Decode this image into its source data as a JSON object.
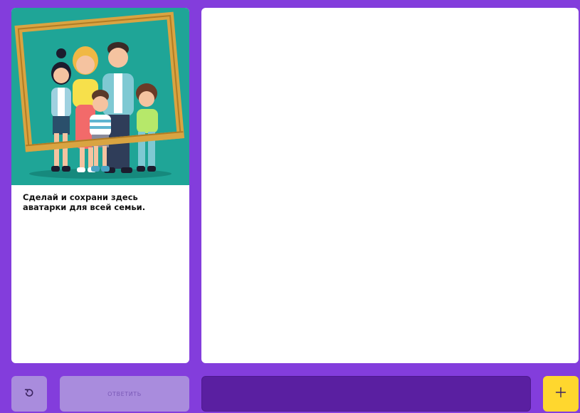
{
  "task": {
    "text": "Сделай и сохрани здесь аватарки для всей семьи.",
    "illustration": "family-in-frame-illustration"
  },
  "controls": {
    "reset_icon": "undo-icon",
    "answer_label": "ОТВЕТИТЬ",
    "add_icon": "plus-icon"
  },
  "colors": {
    "background": "#833ddc",
    "card": "#ffffff",
    "illustration_bg": "#1fa597",
    "button_muted": "#a98cdd",
    "answer_field": "#5a1fa1",
    "add_button": "#ffd72e"
  }
}
